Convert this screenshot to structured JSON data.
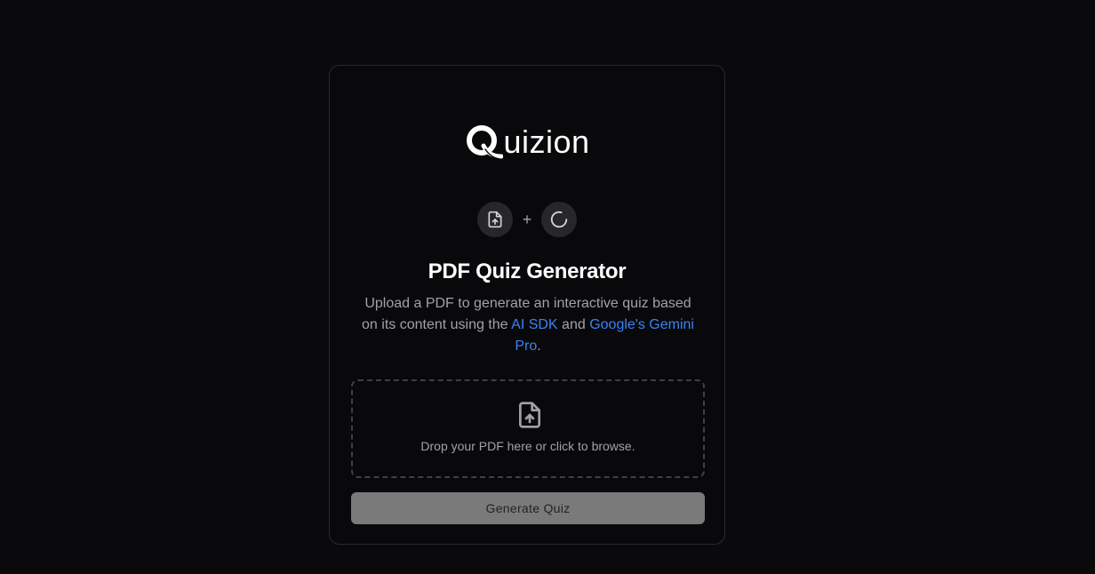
{
  "brand": {
    "logo_text": "uizion",
    "logo_icon": "q-swirl-logo-icon"
  },
  "icons": {
    "upload": "file-upload-icon",
    "plus": "+",
    "loader": "loader-circle-icon"
  },
  "hero": {
    "title": "PDF Quiz Generator",
    "description_prefix": "Upload a PDF to generate an interactive quiz based on its content using the ",
    "link_ai_sdk": "AI SDK",
    "description_middle": " and ",
    "link_gemini": "Google's Gemini Pro",
    "description_suffix": "."
  },
  "dropzone": {
    "icon": "file-upload-icon",
    "text": "Drop your PDF here or click to browse."
  },
  "actions": {
    "generate_label": "Generate Quiz",
    "generate_disabled": true
  },
  "colors": {
    "background": "#0a0a0c",
    "card_border": "#2a2a2e",
    "link": "#3b82f6",
    "muted_text": "#a1a1aa",
    "button_disabled": "#7a7a7a"
  }
}
